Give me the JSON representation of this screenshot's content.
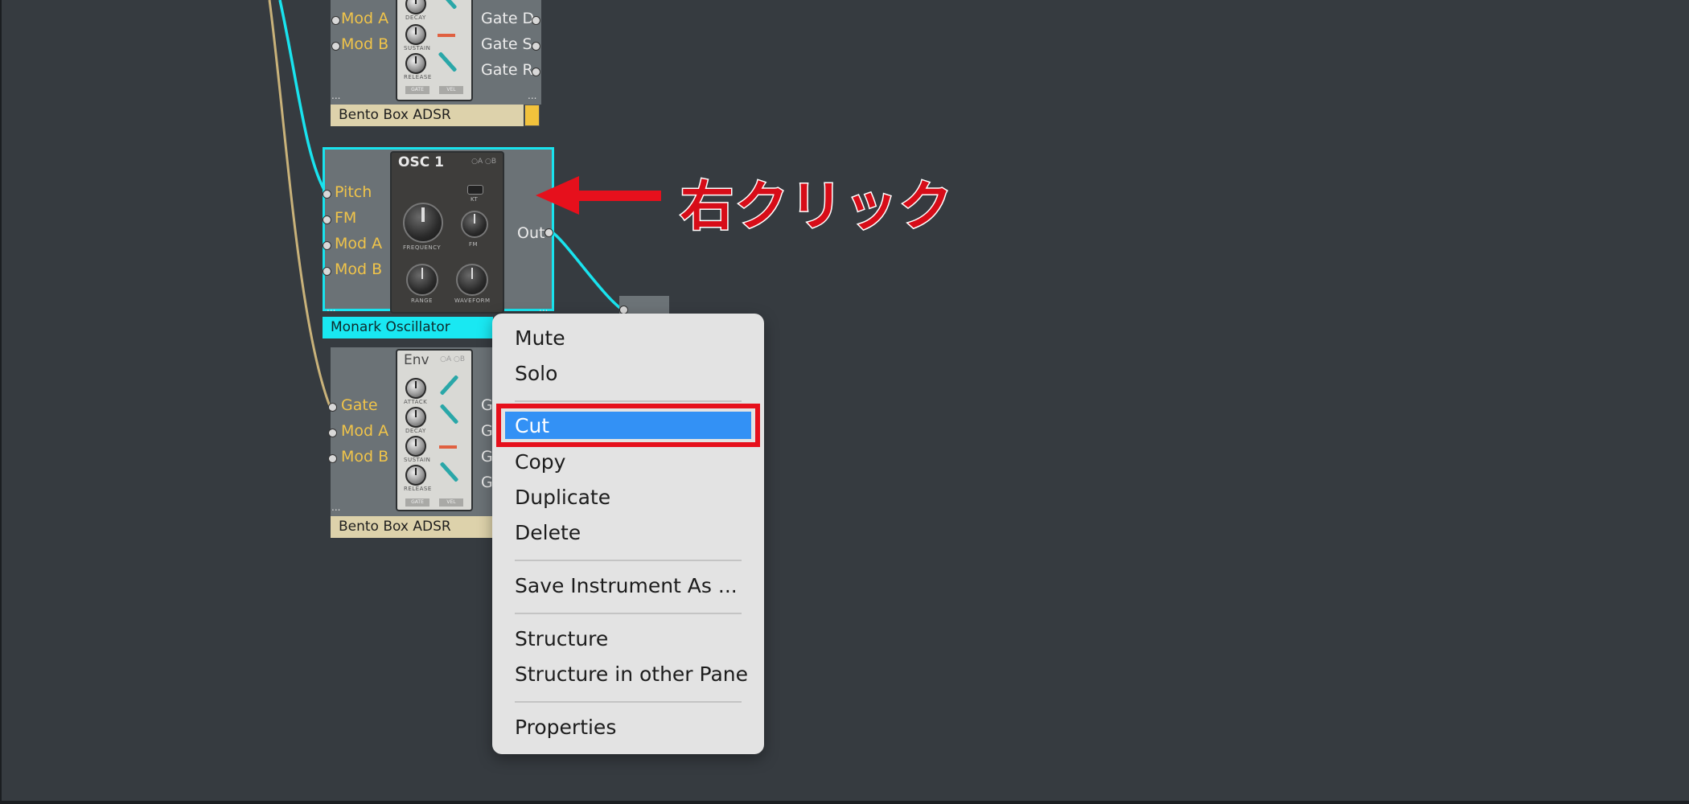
{
  "annotation": {
    "text": "右クリック"
  },
  "modules": {
    "adsr_top": {
      "name": "Bento Box ADSR",
      "inputs": [
        "Mod A",
        "Mod B"
      ],
      "outputs": [
        "Gate D",
        "Gate S",
        "Gate R"
      ],
      "knobs": [
        "DECAY",
        "SUSTAIN",
        "RELEASE"
      ],
      "buttons": [
        "GATE",
        "VEL"
      ],
      "more": "..."
    },
    "oscillator": {
      "name": "Monark Oscillator",
      "panel_title": "OSC 1",
      "panel_badge": "○A ○B",
      "inputs": [
        "Pitch",
        "FM",
        "Mod A",
        "Mod B"
      ],
      "output": "Out",
      "knobs": [
        "FREQUENCY",
        "FM",
        "RANGE",
        "WAVEFORM"
      ],
      "switch_label": "KT",
      "more": "..."
    },
    "adsr_bottom": {
      "name": "Bento Box ADSR",
      "panel_title": "Env",
      "panel_badge": "○A ○B",
      "inputs": [
        "Gate",
        "Mod A",
        "Mod B"
      ],
      "outputs": [
        "G",
        "G",
        "G",
        "G"
      ],
      "knobs": [
        "ATTACK",
        "DECAY",
        "SUSTAIN",
        "RELEASE"
      ],
      "buttons": [
        "GATE",
        "VEL"
      ],
      "more": "..."
    }
  },
  "context_menu": {
    "items": [
      {
        "label": "Mute"
      },
      {
        "label": "Solo"
      },
      {
        "label": "Cut",
        "highlighted": true
      },
      {
        "label": "Copy"
      },
      {
        "label": "Duplicate"
      },
      {
        "label": "Delete"
      },
      {
        "label": "Save Instrument As ..."
      },
      {
        "label": "Structure"
      },
      {
        "label": "Structure in other Pane"
      },
      {
        "label": "Properties"
      }
    ]
  },
  "colors": {
    "background": "#363b40",
    "cable_cyan": "#19e3ee",
    "cable_tan": "#c9b27a",
    "highlight_blue": "#3391f5",
    "annotation_red": "#e6101c"
  }
}
